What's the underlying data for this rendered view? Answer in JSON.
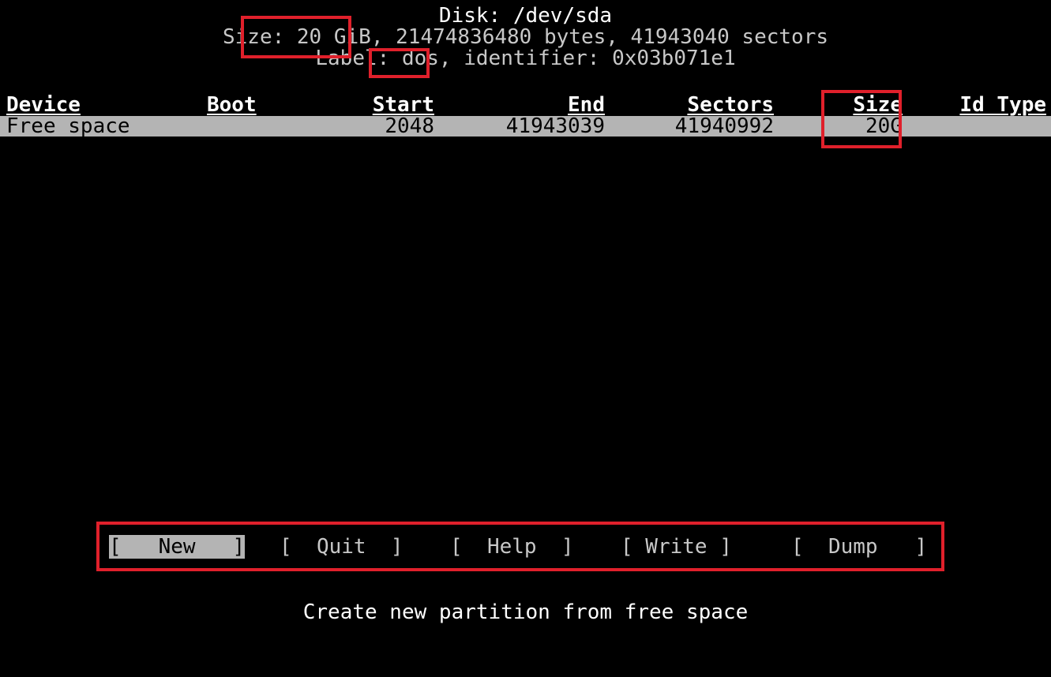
{
  "header": {
    "title": "Disk: /dev/sda",
    "size_prefix": "Size: ",
    "size_value": "20 GiB,",
    "size_rest": " 21474836480 bytes, 41943040 sectors",
    "label_prefix": "Label: ",
    "label_value": "dos",
    "label_rest": ", identifier: 0x03b071e1"
  },
  "table": {
    "columns": [
      "Device",
      "Boot",
      "Start",
      "End",
      "Sectors",
      "Size",
      "Id Type"
    ],
    "rows": [
      {
        "device": "Free space",
        "boot": "",
        "start": "2048",
        "end": "41943039",
        "sectors": "41940992",
        "size": "20G",
        "id_type": ""
      }
    ]
  },
  "menu": {
    "items": [
      {
        "label": "[   New   ]",
        "selected": true
      },
      {
        "label": "[  Quit  ]",
        "selected": false
      },
      {
        "label": "[  Help  ]",
        "selected": false
      },
      {
        "label": "[ Write ]",
        "selected": false
      },
      {
        "label": "[  Dump   ]",
        "selected": false
      }
    ]
  },
  "status": {
    "hint": "Create new partition from free space"
  },
  "colors": {
    "background": "#000000",
    "text": "#c8c8c8",
    "selection": "#b4b4b4",
    "highlight_box": "#e0202b"
  }
}
